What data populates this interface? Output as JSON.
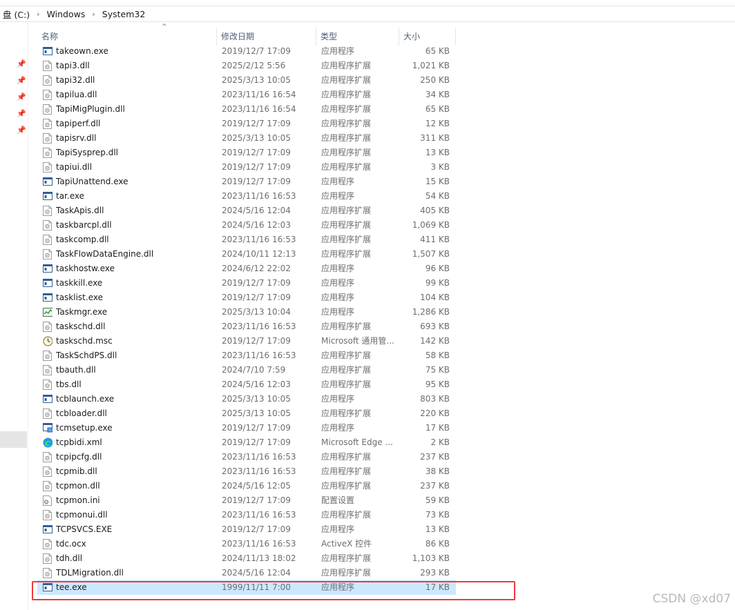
{
  "breadcrumb": [
    "盘 (C:)",
    "Windows",
    "System32"
  ],
  "columns": {
    "name": "名称",
    "date": "修改日期",
    "type": "类型",
    "size": "大小"
  },
  "files": [
    {
      "name": "takeown.exe",
      "date": "2019/12/7 17:09",
      "type": "应用程序",
      "size": "65 KB",
      "icon": "exe-icon"
    },
    {
      "name": "tapi3.dll",
      "date": "2025/2/12 5:56",
      "type": "应用程序扩展",
      "size": "1,021 KB",
      "icon": "dll-icon"
    },
    {
      "name": "tapi32.dll",
      "date": "2025/3/13 10:05",
      "type": "应用程序扩展",
      "size": "250 KB",
      "icon": "dll-icon"
    },
    {
      "name": "tapilua.dll",
      "date": "2023/11/16 16:54",
      "type": "应用程序扩展",
      "size": "34 KB",
      "icon": "dll-icon"
    },
    {
      "name": "TapiMigPlugin.dll",
      "date": "2023/11/16 16:54",
      "type": "应用程序扩展",
      "size": "65 KB",
      "icon": "dll-icon"
    },
    {
      "name": "tapiperf.dll",
      "date": "2019/12/7 17:09",
      "type": "应用程序扩展",
      "size": "12 KB",
      "icon": "dll-icon"
    },
    {
      "name": "tapisrv.dll",
      "date": "2025/3/13 10:05",
      "type": "应用程序扩展",
      "size": "311 KB",
      "icon": "dll-icon"
    },
    {
      "name": "TapiSysprep.dll",
      "date": "2019/12/7 17:09",
      "type": "应用程序扩展",
      "size": "13 KB",
      "icon": "dll-icon"
    },
    {
      "name": "tapiui.dll",
      "date": "2019/12/7 17:09",
      "type": "应用程序扩展",
      "size": "3 KB",
      "icon": "dll-icon"
    },
    {
      "name": "TapiUnattend.exe",
      "date": "2019/12/7 17:09",
      "type": "应用程序",
      "size": "15 KB",
      "icon": "exe-icon"
    },
    {
      "name": "tar.exe",
      "date": "2023/11/16 16:53",
      "type": "应用程序",
      "size": "54 KB",
      "icon": "exe-icon"
    },
    {
      "name": "TaskApis.dll",
      "date": "2024/5/16 12:04",
      "type": "应用程序扩展",
      "size": "405 KB",
      "icon": "dll-icon"
    },
    {
      "name": "taskbarcpl.dll",
      "date": "2024/5/16 12:03",
      "type": "应用程序扩展",
      "size": "1,069 KB",
      "icon": "dll-icon"
    },
    {
      "name": "taskcomp.dll",
      "date": "2023/11/16 16:53",
      "type": "应用程序扩展",
      "size": "411 KB",
      "icon": "dll-icon"
    },
    {
      "name": "TaskFlowDataEngine.dll",
      "date": "2024/10/11 12:13",
      "type": "应用程序扩展",
      "size": "1,507 KB",
      "icon": "dll-icon"
    },
    {
      "name": "taskhostw.exe",
      "date": "2024/6/12 22:02",
      "type": "应用程序",
      "size": "96 KB",
      "icon": "exe-icon"
    },
    {
      "name": "taskkill.exe",
      "date": "2019/12/7 17:09",
      "type": "应用程序",
      "size": "99 KB",
      "icon": "exe-icon"
    },
    {
      "name": "tasklist.exe",
      "date": "2019/12/7 17:09",
      "type": "应用程序",
      "size": "104 KB",
      "icon": "exe-icon"
    },
    {
      "name": "Taskmgr.exe",
      "date": "2025/3/13 10:04",
      "type": "应用程序",
      "size": "1,286 KB",
      "icon": "taskmgr-icon"
    },
    {
      "name": "taskschd.dll",
      "date": "2023/11/16 16:53",
      "type": "应用程序扩展",
      "size": "693 KB",
      "icon": "dll-icon"
    },
    {
      "name": "taskschd.msc",
      "date": "2019/12/7 17:09",
      "type": "Microsoft 通用管...",
      "size": "142 KB",
      "icon": "clock-icon"
    },
    {
      "name": "TaskSchdPS.dll",
      "date": "2023/11/16 16:53",
      "type": "应用程序扩展",
      "size": "58 KB",
      "icon": "dll-icon"
    },
    {
      "name": "tbauth.dll",
      "date": "2024/7/10 7:59",
      "type": "应用程序扩展",
      "size": "75 KB",
      "icon": "dll-icon"
    },
    {
      "name": "tbs.dll",
      "date": "2024/5/16 12:03",
      "type": "应用程序扩展",
      "size": "95 KB",
      "icon": "dll-icon"
    },
    {
      "name": "tcblaunch.exe",
      "date": "2025/3/13 10:05",
      "type": "应用程序",
      "size": "803 KB",
      "icon": "exe-icon"
    },
    {
      "name": "tcbloader.dll",
      "date": "2025/3/13 10:05",
      "type": "应用程序扩展",
      "size": "220 KB",
      "icon": "dll-icon"
    },
    {
      "name": "tcmsetup.exe",
      "date": "2019/12/7 17:09",
      "type": "应用程序",
      "size": "17 KB",
      "icon": "setup-icon"
    },
    {
      "name": "tcpbidi.xml",
      "date": "2019/12/7 17:09",
      "type": "Microsoft Edge ...",
      "size": "2 KB",
      "icon": "edge-icon"
    },
    {
      "name": "tcpipcfg.dll",
      "date": "2023/11/16 16:53",
      "type": "应用程序扩展",
      "size": "237 KB",
      "icon": "dll-icon"
    },
    {
      "name": "tcpmib.dll",
      "date": "2023/11/16 16:53",
      "type": "应用程序扩展",
      "size": "38 KB",
      "icon": "dll-icon"
    },
    {
      "name": "tcpmon.dll",
      "date": "2024/5/16 12:05",
      "type": "应用程序扩展",
      "size": "237 KB",
      "icon": "dll-icon"
    },
    {
      "name": "tcpmon.ini",
      "date": "2019/12/7 17:09",
      "type": "配置设置",
      "size": "59 KB",
      "icon": "ini-icon"
    },
    {
      "name": "tcpmonui.dll",
      "date": "2023/11/16 16:53",
      "type": "应用程序扩展",
      "size": "73 KB",
      "icon": "dll-icon"
    },
    {
      "name": "TCPSVCS.EXE",
      "date": "2019/12/7 17:09",
      "type": "应用程序",
      "size": "13 KB",
      "icon": "exe-icon"
    },
    {
      "name": "tdc.ocx",
      "date": "2023/11/16 16:53",
      "type": "ActiveX 控件",
      "size": "86 KB",
      "icon": "dll-icon"
    },
    {
      "name": "tdh.dll",
      "date": "2024/11/13 18:02",
      "type": "应用程序扩展",
      "size": "1,103 KB",
      "icon": "dll-icon"
    },
    {
      "name": "TDLMigration.dll",
      "date": "2024/5/16 12:04",
      "type": "应用程序扩展",
      "size": "293 KB",
      "icon": "dll-icon"
    },
    {
      "name": "tee.exe",
      "date": "1999/11/11 7:00",
      "type": "应用程序",
      "size": "17 KB",
      "icon": "exe-icon",
      "selected": true
    }
  ],
  "watermark": "CSDN @xd07",
  "colors": {
    "selection": "#cce8ff",
    "highlight_box": "#ef3a3a"
  }
}
